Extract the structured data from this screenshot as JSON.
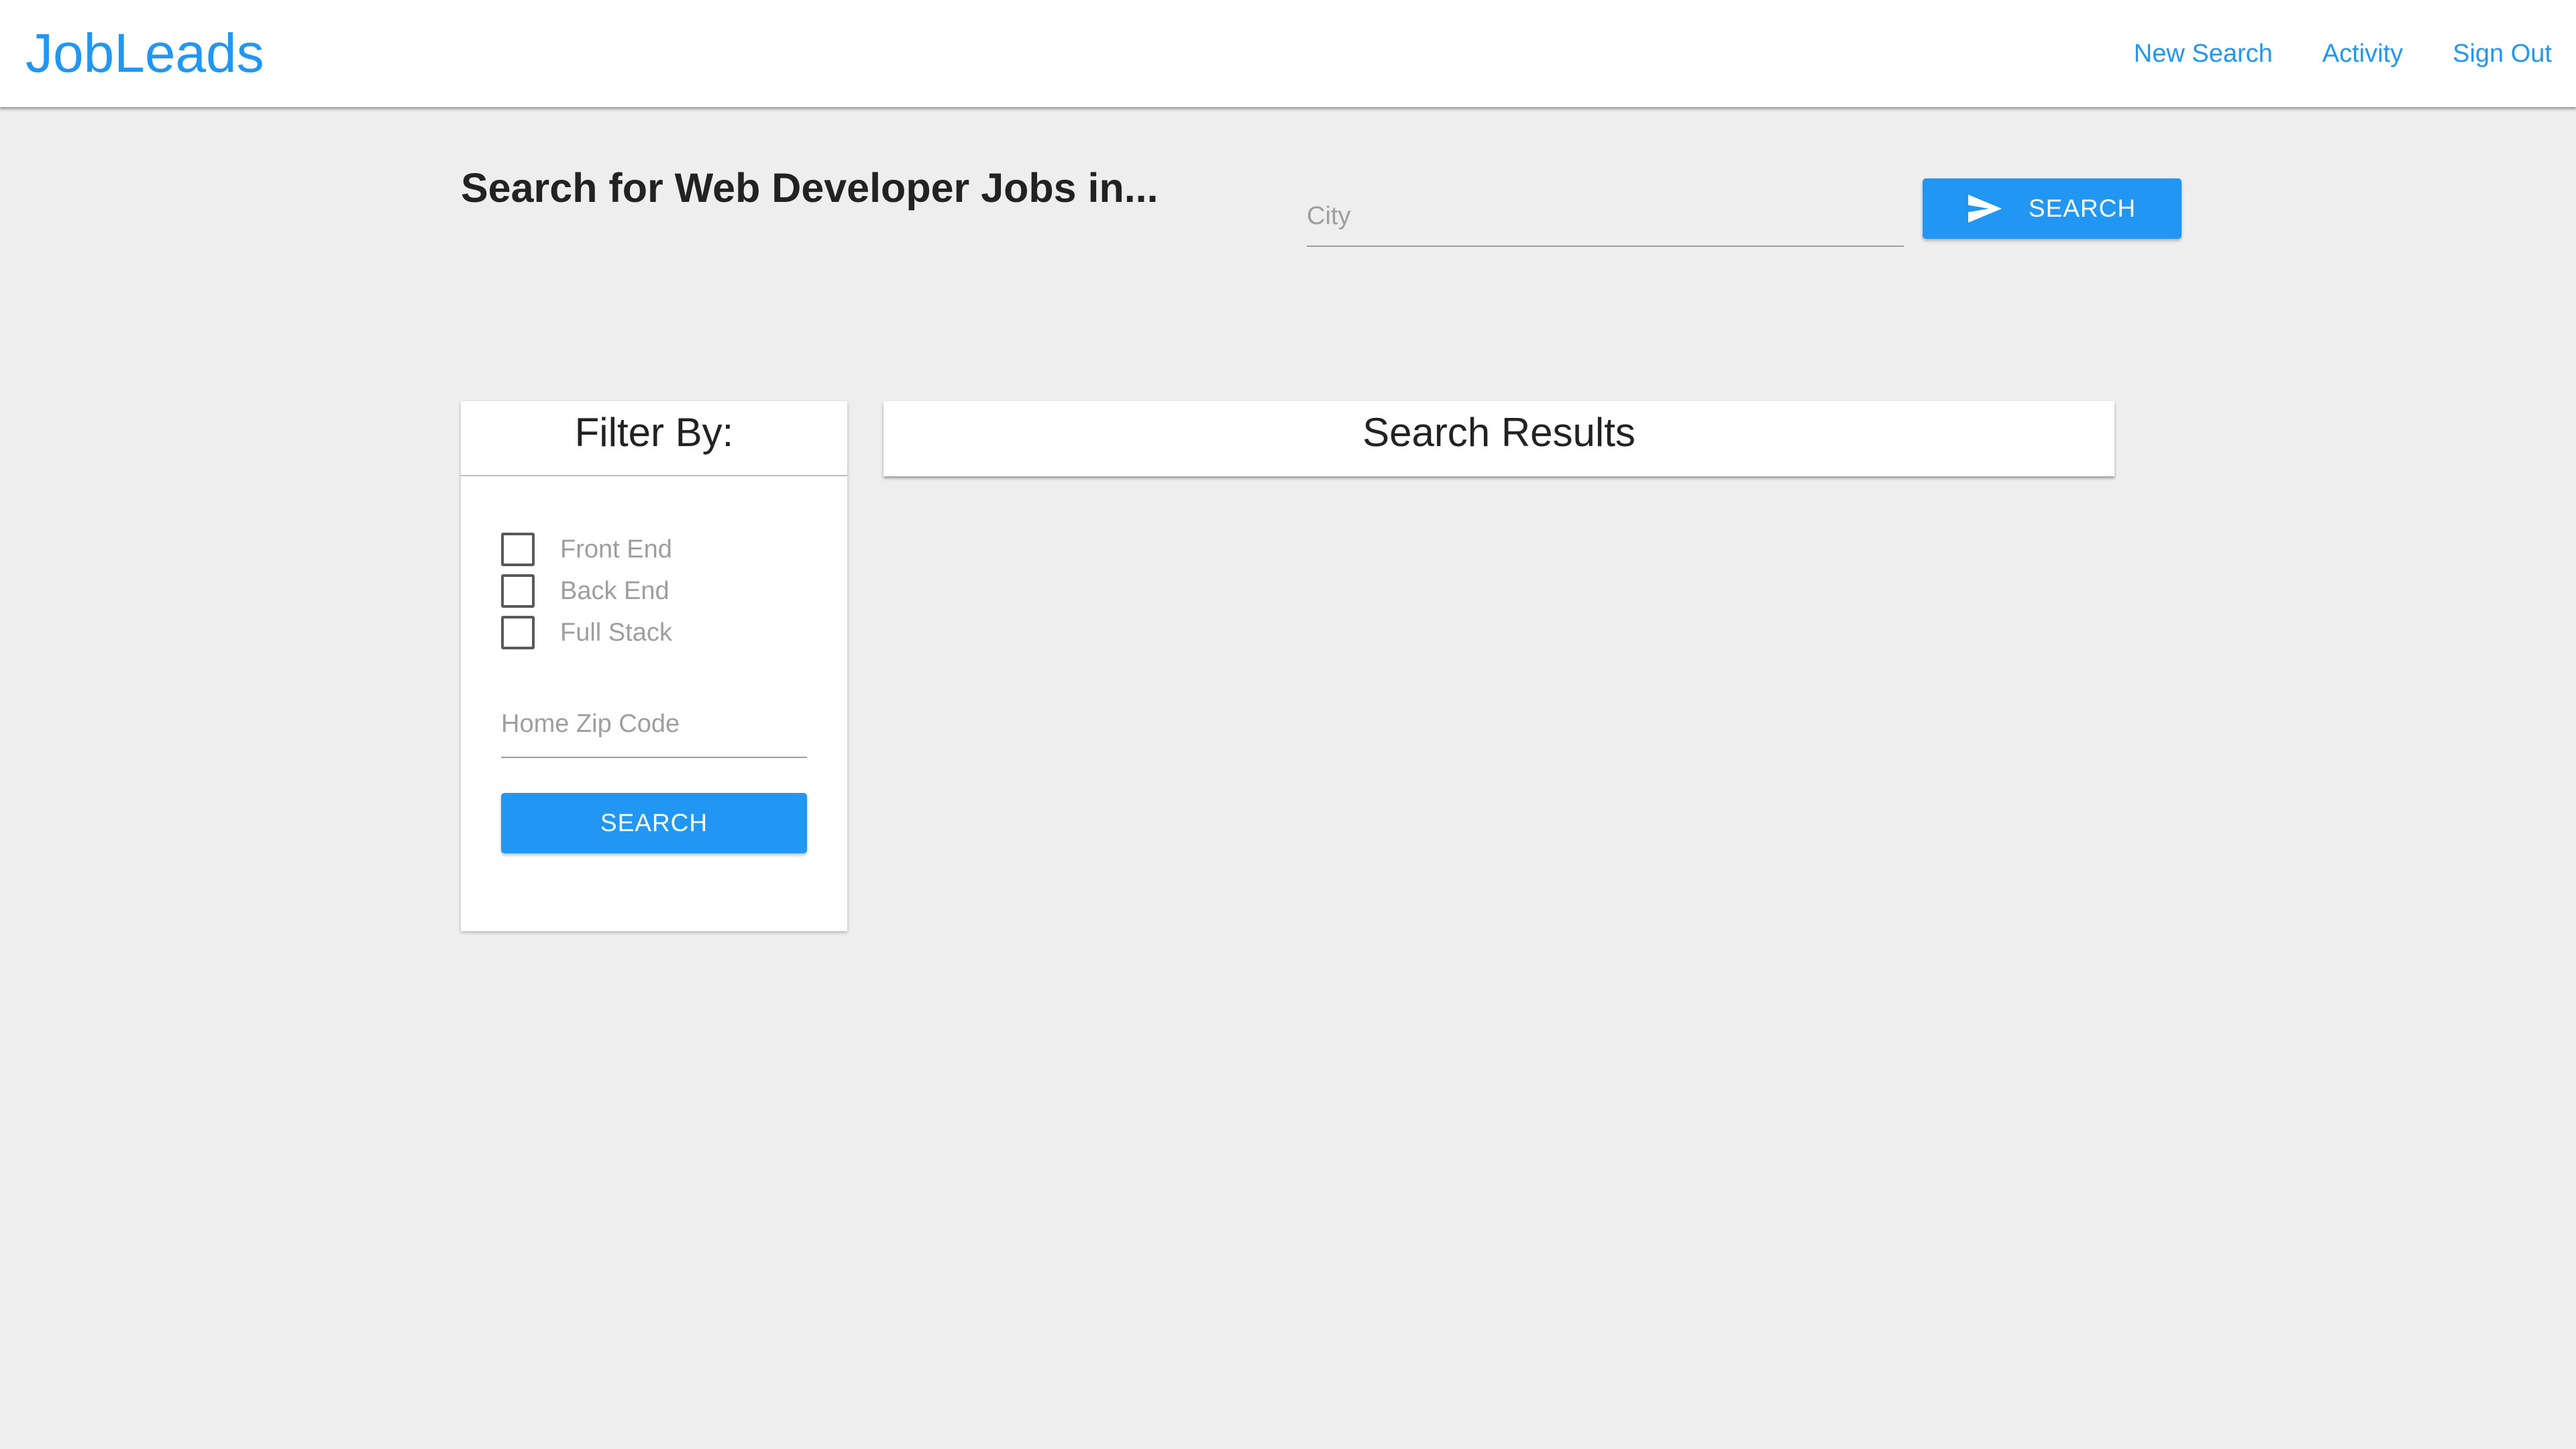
{
  "navbar": {
    "brand": "JobLeads",
    "links": [
      "New Search",
      "Activity",
      "Sign Out"
    ]
  },
  "search": {
    "heading": "Search for Web Developer Jobs in...",
    "city_placeholder": "City",
    "button_label": "SEARCH",
    "button_icon": "send-icon"
  },
  "filter": {
    "title": "Filter By:",
    "options": [
      {
        "label": "Front End",
        "checked": false
      },
      {
        "label": "Back End",
        "checked": false
      },
      {
        "label": "Full Stack",
        "checked": false
      }
    ],
    "zip_placeholder": "Home Zip Code",
    "button_label": "SEARCH"
  },
  "results": {
    "title": "Search Results"
  },
  "colors": {
    "accent": "#2196f3",
    "background": "#eeeeee",
    "card": "#ffffff"
  }
}
